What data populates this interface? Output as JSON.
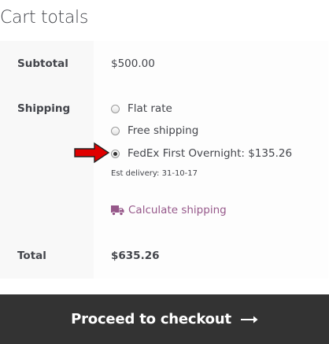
{
  "title": "Cart totals",
  "subtotal": {
    "label": "Subtotal",
    "value": "$500.00"
  },
  "shipping": {
    "label": "Shipping",
    "options": [
      {
        "label": "Flat rate",
        "selected": false
      },
      {
        "label": "Free shipping",
        "selected": false
      },
      {
        "label": "FedEx First Overnight: $135.26",
        "selected": true
      }
    ],
    "est_delivery": "Est delivery: 31-10-17",
    "calculate_label": "Calculate shipping",
    "calculate_icon": "truck-icon"
  },
  "total": {
    "label": "Total",
    "value": "$635.26"
  },
  "checkout": {
    "label": "Proceed to checkout",
    "icon": "long-arrow-right-icon"
  },
  "annotation": {
    "icon": "red-pointer-arrow-icon"
  },
  "colors": {
    "link": "#96588a",
    "button_bg": "#333333",
    "button_text": "#ffffff",
    "text": "#43454b",
    "annotation_arrow": "#e00000"
  }
}
